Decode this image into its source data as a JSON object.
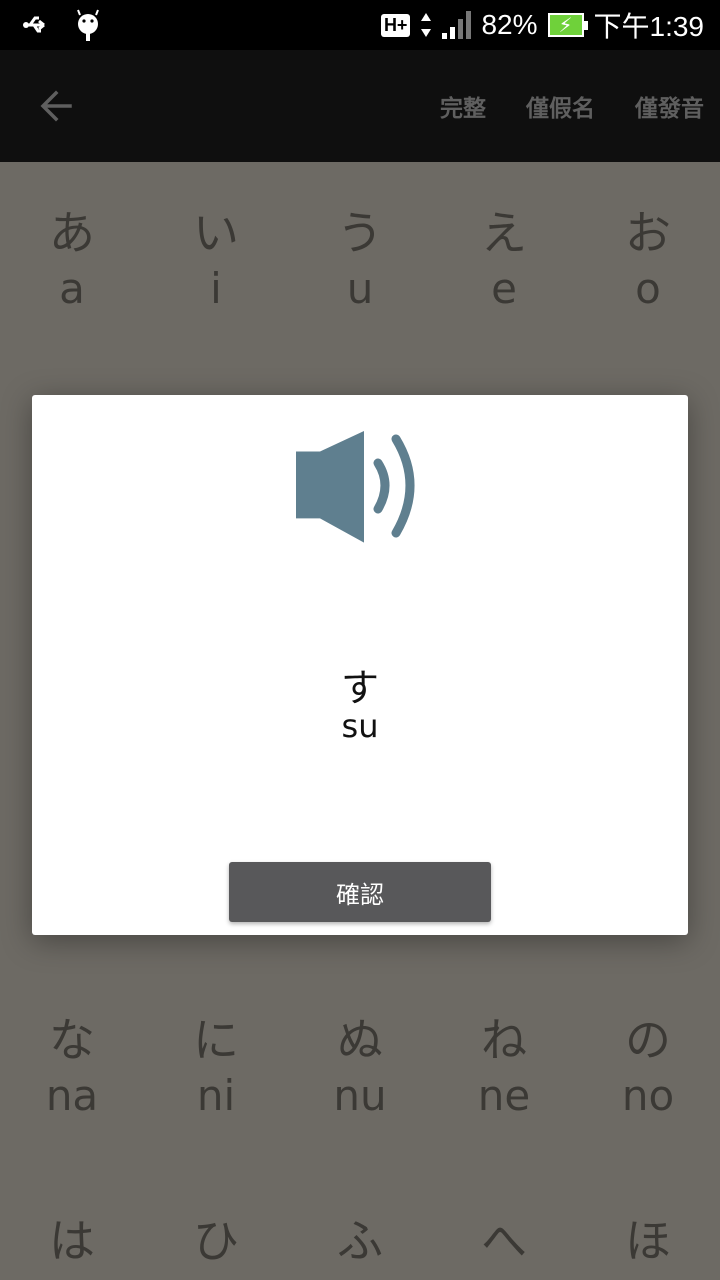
{
  "status_bar": {
    "battery_percent": "82%",
    "time": "下午1:39",
    "network": "H+"
  },
  "toolbar": {
    "back_icon": "arrow-left-icon",
    "actions": [
      "完整",
      "僅假名",
      "僅發音"
    ]
  },
  "grid": [
    [
      [
        "あ",
        "a"
      ],
      [
        "い",
        "i"
      ],
      [
        "う",
        "u"
      ],
      [
        "え",
        "e"
      ],
      [
        "お",
        "o"
      ]
    ],
    [
      [
        "な",
        "na"
      ],
      [
        "に",
        "ni"
      ],
      [
        "ぬ",
        "nu"
      ],
      [
        "ね",
        "ne"
      ],
      [
        "の",
        "no"
      ]
    ],
    [
      [
        "は",
        ""
      ],
      [
        "ひ",
        ""
      ],
      [
        "ふ",
        ""
      ],
      [
        "へ",
        ""
      ],
      [
        "ほ",
        ""
      ]
    ]
  ],
  "dialog": {
    "icon": "speaker-icon",
    "kana": "す",
    "romaji": "su",
    "confirm_label": "確認"
  },
  "colors": {
    "toolbar_bg": "#0f0f0f",
    "scrim_bg": "#6d6a64",
    "speaker": "#5f7f8f",
    "button_bg": "#58585a"
  }
}
